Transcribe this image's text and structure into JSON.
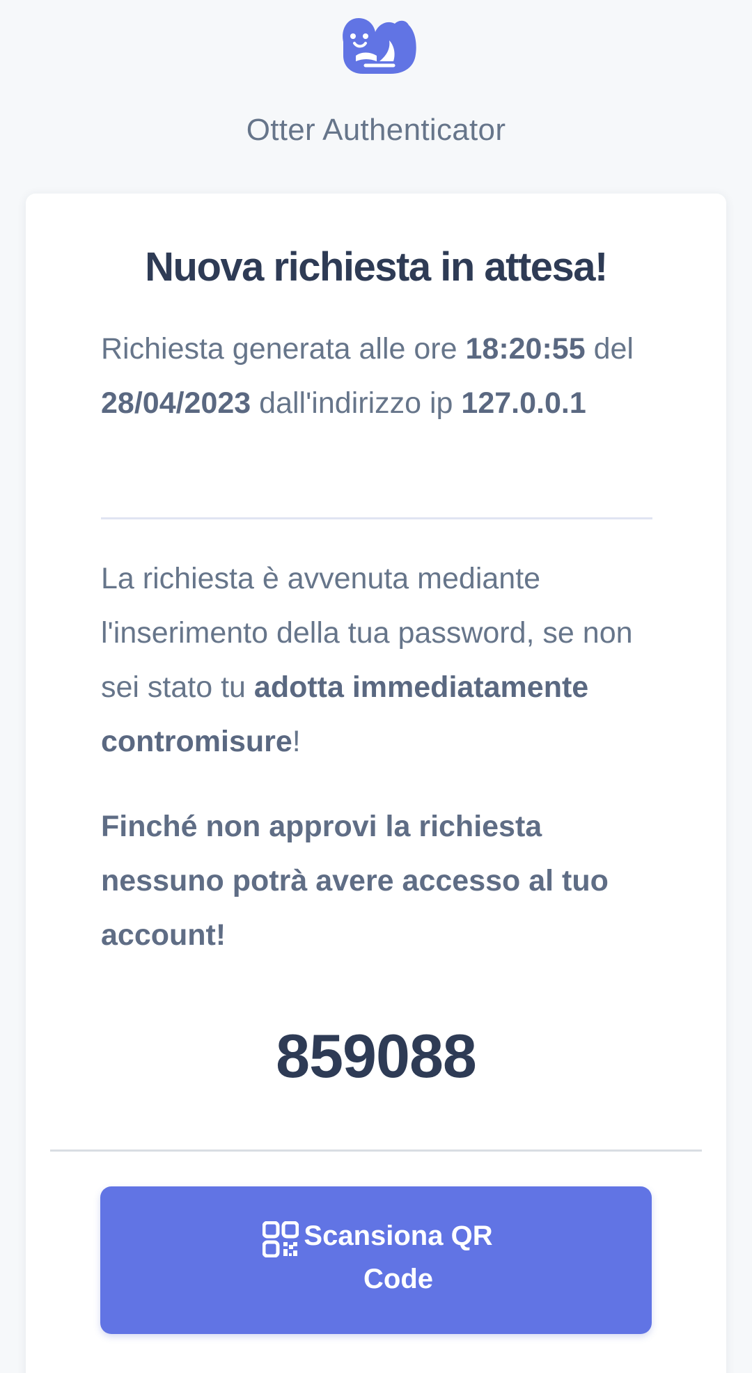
{
  "header": {
    "app_name": "Otter Authenticator",
    "logo_icon": "otter-logo-icon"
  },
  "card": {
    "title": "Nuova richiesta in attesa!",
    "info": {
      "text_1": "Richiesta generata alle ore ",
      "time": "18:20:55",
      "text_2": " del ",
      "date": "28/04/2023",
      "text_3": " dall'indirizzo ip ",
      "ip": "127.0.0.1"
    },
    "warning": {
      "text_1": "La richiesta è avvenuta mediante l'inserimento della tua password, se non sei stato tu ",
      "emphasis": "adotta immediatamente contromisure",
      "text_2": "!"
    },
    "notice": "Finché non approvi la richiesta nessuno potrà avere accesso al tuo account!",
    "code": "859088",
    "scan_button": {
      "label": "Scansiona QR Code",
      "icon": "qr-code-icon"
    }
  },
  "colors": {
    "background": "#f6f8fa",
    "card": "#ffffff",
    "accent": "#6174e4",
    "title_text": "#2e3b55",
    "body_text": "#66758a"
  }
}
